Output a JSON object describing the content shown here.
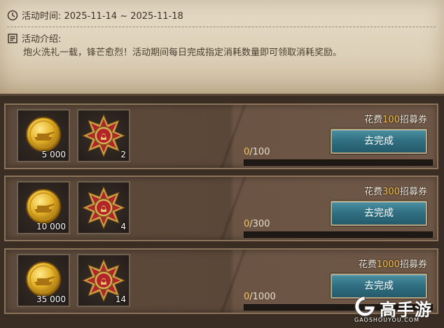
{
  "event": {
    "time_label": "活动时间: 2025-11-14 ~ 2025-11-18",
    "intro_title": "活动介绍:",
    "intro_text": "炮火洗礼一载，锋芒愈烈！活动期间每日完成指定消耗数量即可领取消耗奖励。"
  },
  "tasks": [
    {
      "cost_prefix": "花费",
      "cost_num": "100",
      "cost_suffix": "招募券",
      "button": "去完成",
      "progress_cur": "0",
      "progress_total": "/100",
      "progress": 0,
      "rewards": [
        {
          "icon": "gold-coin-icon",
          "count": "5 000"
        },
        {
          "icon": "medal-icon",
          "count": "2"
        }
      ]
    },
    {
      "cost_prefix": "花费",
      "cost_num": "300",
      "cost_suffix": "招募券",
      "button": "去完成",
      "progress_cur": "0",
      "progress_total": "/300",
      "progress": 0,
      "rewards": [
        {
          "icon": "gold-coin-icon",
          "count": "10 000"
        },
        {
          "icon": "medal-icon",
          "count": "4"
        }
      ]
    },
    {
      "cost_prefix": "花费",
      "cost_num": "1000",
      "cost_suffix": "招募券",
      "button": "去完成",
      "progress_cur": "0",
      "progress_total": "/1000",
      "progress": 0,
      "rewards": [
        {
          "icon": "gold-coin-icon",
          "count": "35 000"
        },
        {
          "icon": "medal-icon",
          "count": "14"
        }
      ]
    }
  ],
  "watermark": {
    "title": "高手游",
    "sub": "GAOSHOUYOU.COM"
  },
  "colors": {
    "accent_gold": "#f1c152",
    "button": "#2f6e80"
  }
}
